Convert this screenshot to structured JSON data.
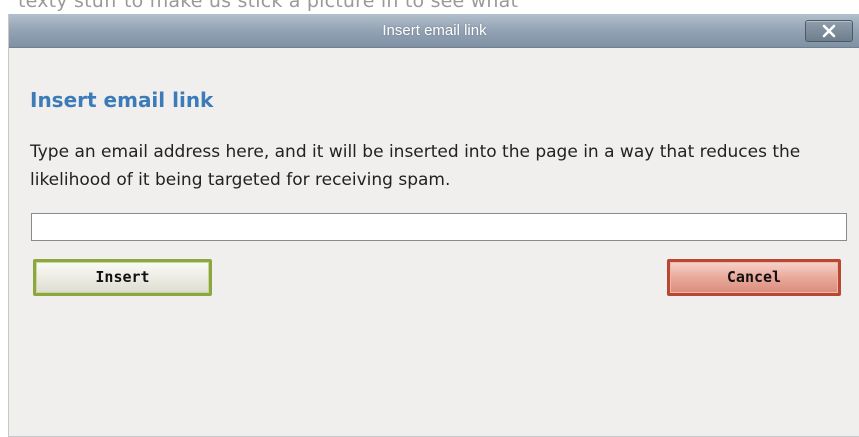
{
  "background": {
    "partial_text": "texty stuff to make us stick a picture in to see what"
  },
  "dialog": {
    "title": "Insert email link",
    "close_label": "✕",
    "heading": "Insert email link",
    "description": "Type an email address here, and it will be inserted into the page in a way that reduces the likelihood of it being targeted for receiving spam.",
    "email_input": {
      "value": "",
      "placeholder": ""
    },
    "insert_label": "Insert",
    "cancel_label": "Cancel"
  },
  "colors": {
    "heading": "#3a7bb8",
    "titlebar": "#93a3b4",
    "insert_border": "#8da63f",
    "cancel_border": "#b84832",
    "dialog_bg": "#f0efed"
  },
  "icons": {
    "close": "close-icon"
  }
}
